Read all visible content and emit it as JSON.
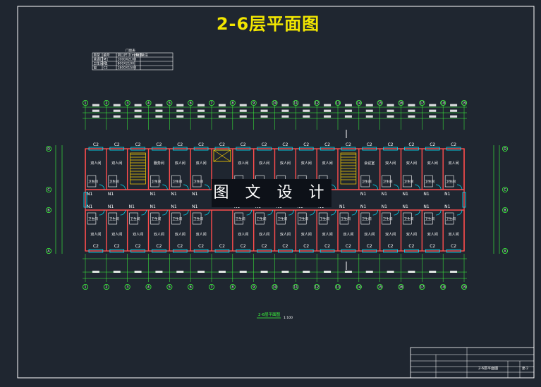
{
  "title": "2-6层平面图",
  "watermark": "图 文 设 计",
  "door_table": {
    "title": "门窗表",
    "headers": [
      "类型",
      "编号",
      "洞口尺寸(mm)",
      "数量",
      "备注"
    ],
    "rows": [
      [
        "普通门",
        "M1",
        "1000X2100",
        "",
        ""
      ],
      [
        "卫生间门",
        "N1",
        "800X2100",
        "",
        ""
      ],
      [
        "窗",
        "C2",
        "1800X1500",
        "",
        ""
      ]
    ]
  },
  "axes_top": [
    "1",
    "2",
    "3",
    "4",
    "5",
    "6",
    "7",
    "8",
    "9",
    "10",
    "11",
    "12",
    "13",
    "14",
    "15",
    "16",
    "17",
    "18",
    "19"
  ],
  "axes_side": [
    "D",
    "C",
    "B",
    "A"
  ],
  "rooms": {
    "double": "双人间",
    "bath": "卫生间",
    "duty": "服务间",
    "meeting": "会议室"
  },
  "labels": {
    "window_c2": "C2",
    "door_n1": "N1",
    "caption": "2-6层平面图",
    "scale": "1:100"
  },
  "title_block": {
    "drawing": "2-6层平面图",
    "sheet_no": "建-2"
  },
  "colors": {
    "background": "#1f2630",
    "title": "#f2e600",
    "walls": "#ff4d4d",
    "dims": "#3cff3c",
    "windows": "#00e5ff",
    "stairs": "#ffd000"
  }
}
